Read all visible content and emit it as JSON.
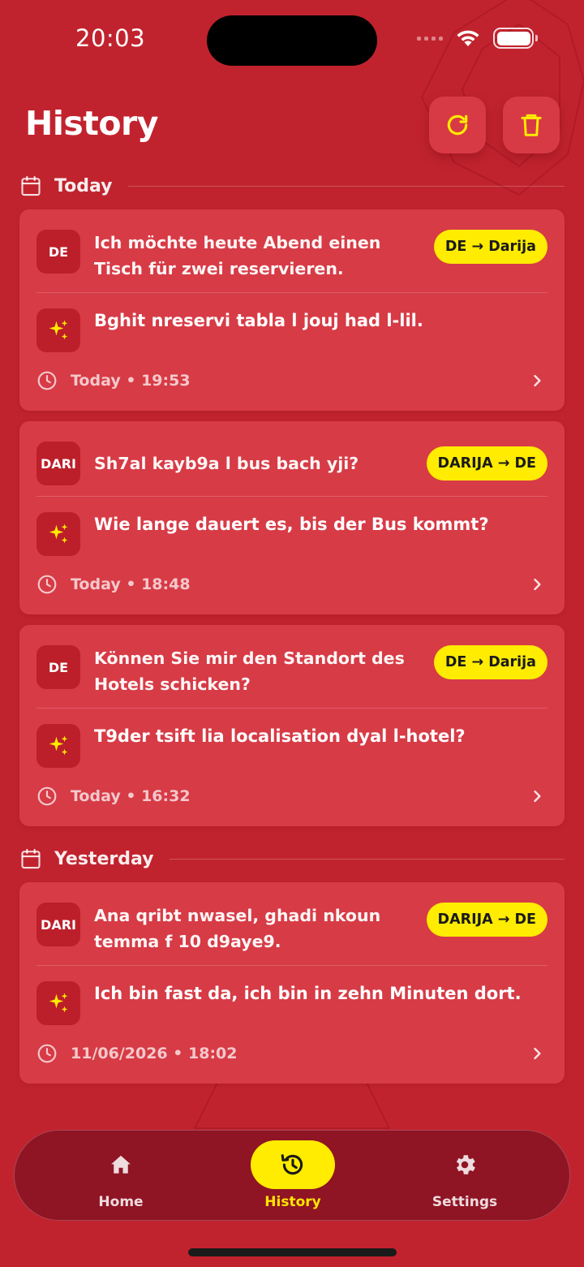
{
  "status_bar": {
    "time": "20:03",
    "icons": [
      "signal-icon",
      "wifi-icon",
      "battery-icon"
    ]
  },
  "header": {
    "title": "History",
    "actions": [
      {
        "name": "refresh",
        "icon": "refresh-icon"
      },
      {
        "name": "delete-all",
        "icon": "trash-icon"
      }
    ]
  },
  "sections": [
    {
      "label": "Today",
      "icon": "calendar-icon",
      "items": [
        {
          "lang_badge": "DE",
          "source": "Ich möchte heute Abend einen Tisch für zwei reservieren.",
          "direction": "DE → Darija",
          "translation": "Bghit nreservi tabla l jouj had l-lil.",
          "timestamp": "Today • 19:53"
        },
        {
          "lang_badge": "DARI",
          "source": "Sh7al kayb9a l bus bach yji?",
          "direction": "DARIJA → DE",
          "translation": "Wie lange dauert es, bis der Bus kommt?",
          "timestamp": "Today • 18:48"
        },
        {
          "lang_badge": "DE",
          "source": "Können Sie mir den Standort des Hotels schicken?",
          "direction": "DE → Darija",
          "translation": "T9der tsift lia localisation dyal l-hotel?",
          "timestamp": "Today • 16:32"
        }
      ]
    },
    {
      "label": "Yesterday",
      "icon": "calendar-icon",
      "items": [
        {
          "lang_badge": "DARI",
          "source": "Ana qribt nwasel, ghadi nkoun temma f 10 d9aye9.",
          "direction": "DARIJA → DE",
          "translation": "Ich bin fast da, ich bin in zehn Minuten dort.",
          "timestamp": "11/06/2026 • 18:02"
        }
      ]
    }
  ],
  "bottom_nav": {
    "items": [
      {
        "label": "Home",
        "icon": "home-icon",
        "active": false
      },
      {
        "label": "History",
        "icon": "history-icon",
        "active": true
      },
      {
        "label": "Settings",
        "icon": "gear-icon",
        "active": false
      }
    ]
  },
  "colors": {
    "background": "#c1232e",
    "card": "#d73b46",
    "badge": "#bc1f2a",
    "accent_yellow": "#ffec00",
    "nav_background": "#8f1424"
  }
}
